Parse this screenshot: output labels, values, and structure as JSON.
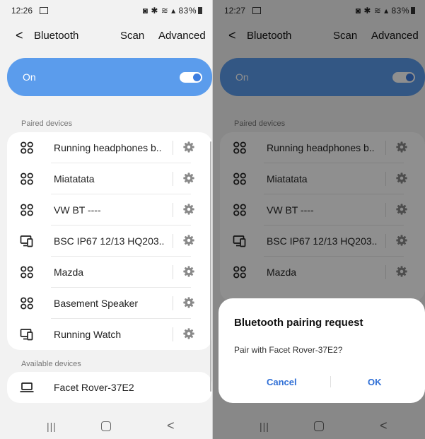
{
  "left": {
    "status": {
      "time": "12:26",
      "right": "◙ ✱ ≋ ▴ 83%"
    },
    "appbar": {
      "title": "Bluetooth",
      "scan": "Scan",
      "advanced": "Advanced"
    },
    "toggle": {
      "label": "On",
      "state": "on"
    },
    "paired_label": "Paired devices",
    "paired": [
      {
        "name": "Running headphones b..",
        "icon": "headphones-icon"
      },
      {
        "name": "Miatatata",
        "icon": "headphones-icon"
      },
      {
        "name": "VW BT ----",
        "icon": "headphones-icon"
      },
      {
        "name": "BSC IP67 12/13 HQ203..",
        "icon": "computer-phone-icon"
      },
      {
        "name": "Mazda",
        "icon": "headphones-icon"
      },
      {
        "name": "Basement Speaker",
        "icon": "headphones-icon"
      },
      {
        "name": "Running Watch",
        "icon": "computer-phone-icon"
      }
    ],
    "available_label": "Available devices",
    "available": [
      {
        "name": "Facet Rover-37E2",
        "icon": "laptop-icon"
      }
    ]
  },
  "right": {
    "status": {
      "time": "12:27",
      "right": "◙ ✱ ≋ ▴ 83%"
    },
    "appbar": {
      "title": "Bluetooth",
      "scan": "Scan",
      "advanced": "Advanced"
    },
    "toggle": {
      "label": "On",
      "state": "on"
    },
    "paired_label": "Paired devices",
    "paired": [
      {
        "name": "Running headphones b..",
        "icon": "headphones-icon"
      },
      {
        "name": "Miatatata",
        "icon": "headphones-icon"
      },
      {
        "name": "VW BT ----",
        "icon": "headphones-icon"
      },
      {
        "name": "BSC IP67 12/13 HQ203..",
        "icon": "computer-phone-icon"
      },
      {
        "name": "Mazda",
        "icon": "headphones-icon"
      }
    ],
    "dialog": {
      "title": "Bluetooth pairing request",
      "message": "Pair with Facet Rover-37E2?",
      "cancel": "Cancel",
      "ok": "OK"
    }
  },
  "colors": {
    "accent": "#5b9cec",
    "link": "#2f6fd6",
    "background": "#f2f2f2"
  }
}
